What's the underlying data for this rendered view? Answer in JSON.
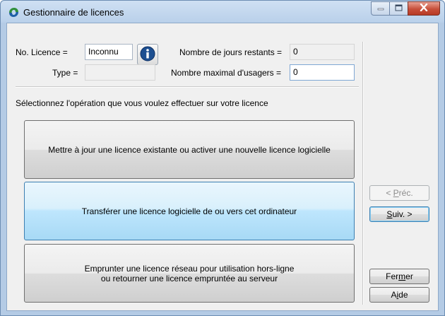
{
  "window": {
    "title": "Gestionnaire de licences",
    "icons": {
      "app": "license-manager-app-icon",
      "minimize": "minimize-icon",
      "maximize": "maximize-icon",
      "close": "close-icon"
    }
  },
  "license": {
    "number_label": "No. Licence =",
    "number_value": "Inconnu",
    "type_label": "Type =",
    "type_value": "",
    "days_label": "Nombre de jours restants =",
    "days_value": "0",
    "max_users_label": "Nombre maximal d'usagers =",
    "max_users_value": "0",
    "info_icon": "info-icon"
  },
  "instruction": "Sélectionnez l'opération que vous voulez effectuer sur votre licence",
  "operations": [
    {
      "line1": "Mettre à jour une licence existante ou activer une nouvelle licence logicielle",
      "line2": ""
    },
    {
      "line1": "Transférer une licence logicielle de ou vers cet ordinateur",
      "line2": ""
    },
    {
      "line1": "Emprunter une licence réseau pour utilisation hors-ligne",
      "line2": "ou retourner une licence empruntée au serveur"
    }
  ],
  "nav": {
    "prev_prefix": "< ",
    "prev_mnemonic": "P",
    "prev_rest": "réc.",
    "next_mnemonic": "S",
    "next_rest": "uiv. >",
    "close_pre": "Fer",
    "close_mnemonic": "m",
    "close_rest": "er",
    "help_pre": "A",
    "help_mnemonic": "i",
    "help_rest": "de"
  },
  "colors": {
    "title_bar": "#b9d0ea",
    "close_button": "#c74f3a",
    "selected_option": "#bee6fd",
    "info_icon": "#1d4f91"
  }
}
